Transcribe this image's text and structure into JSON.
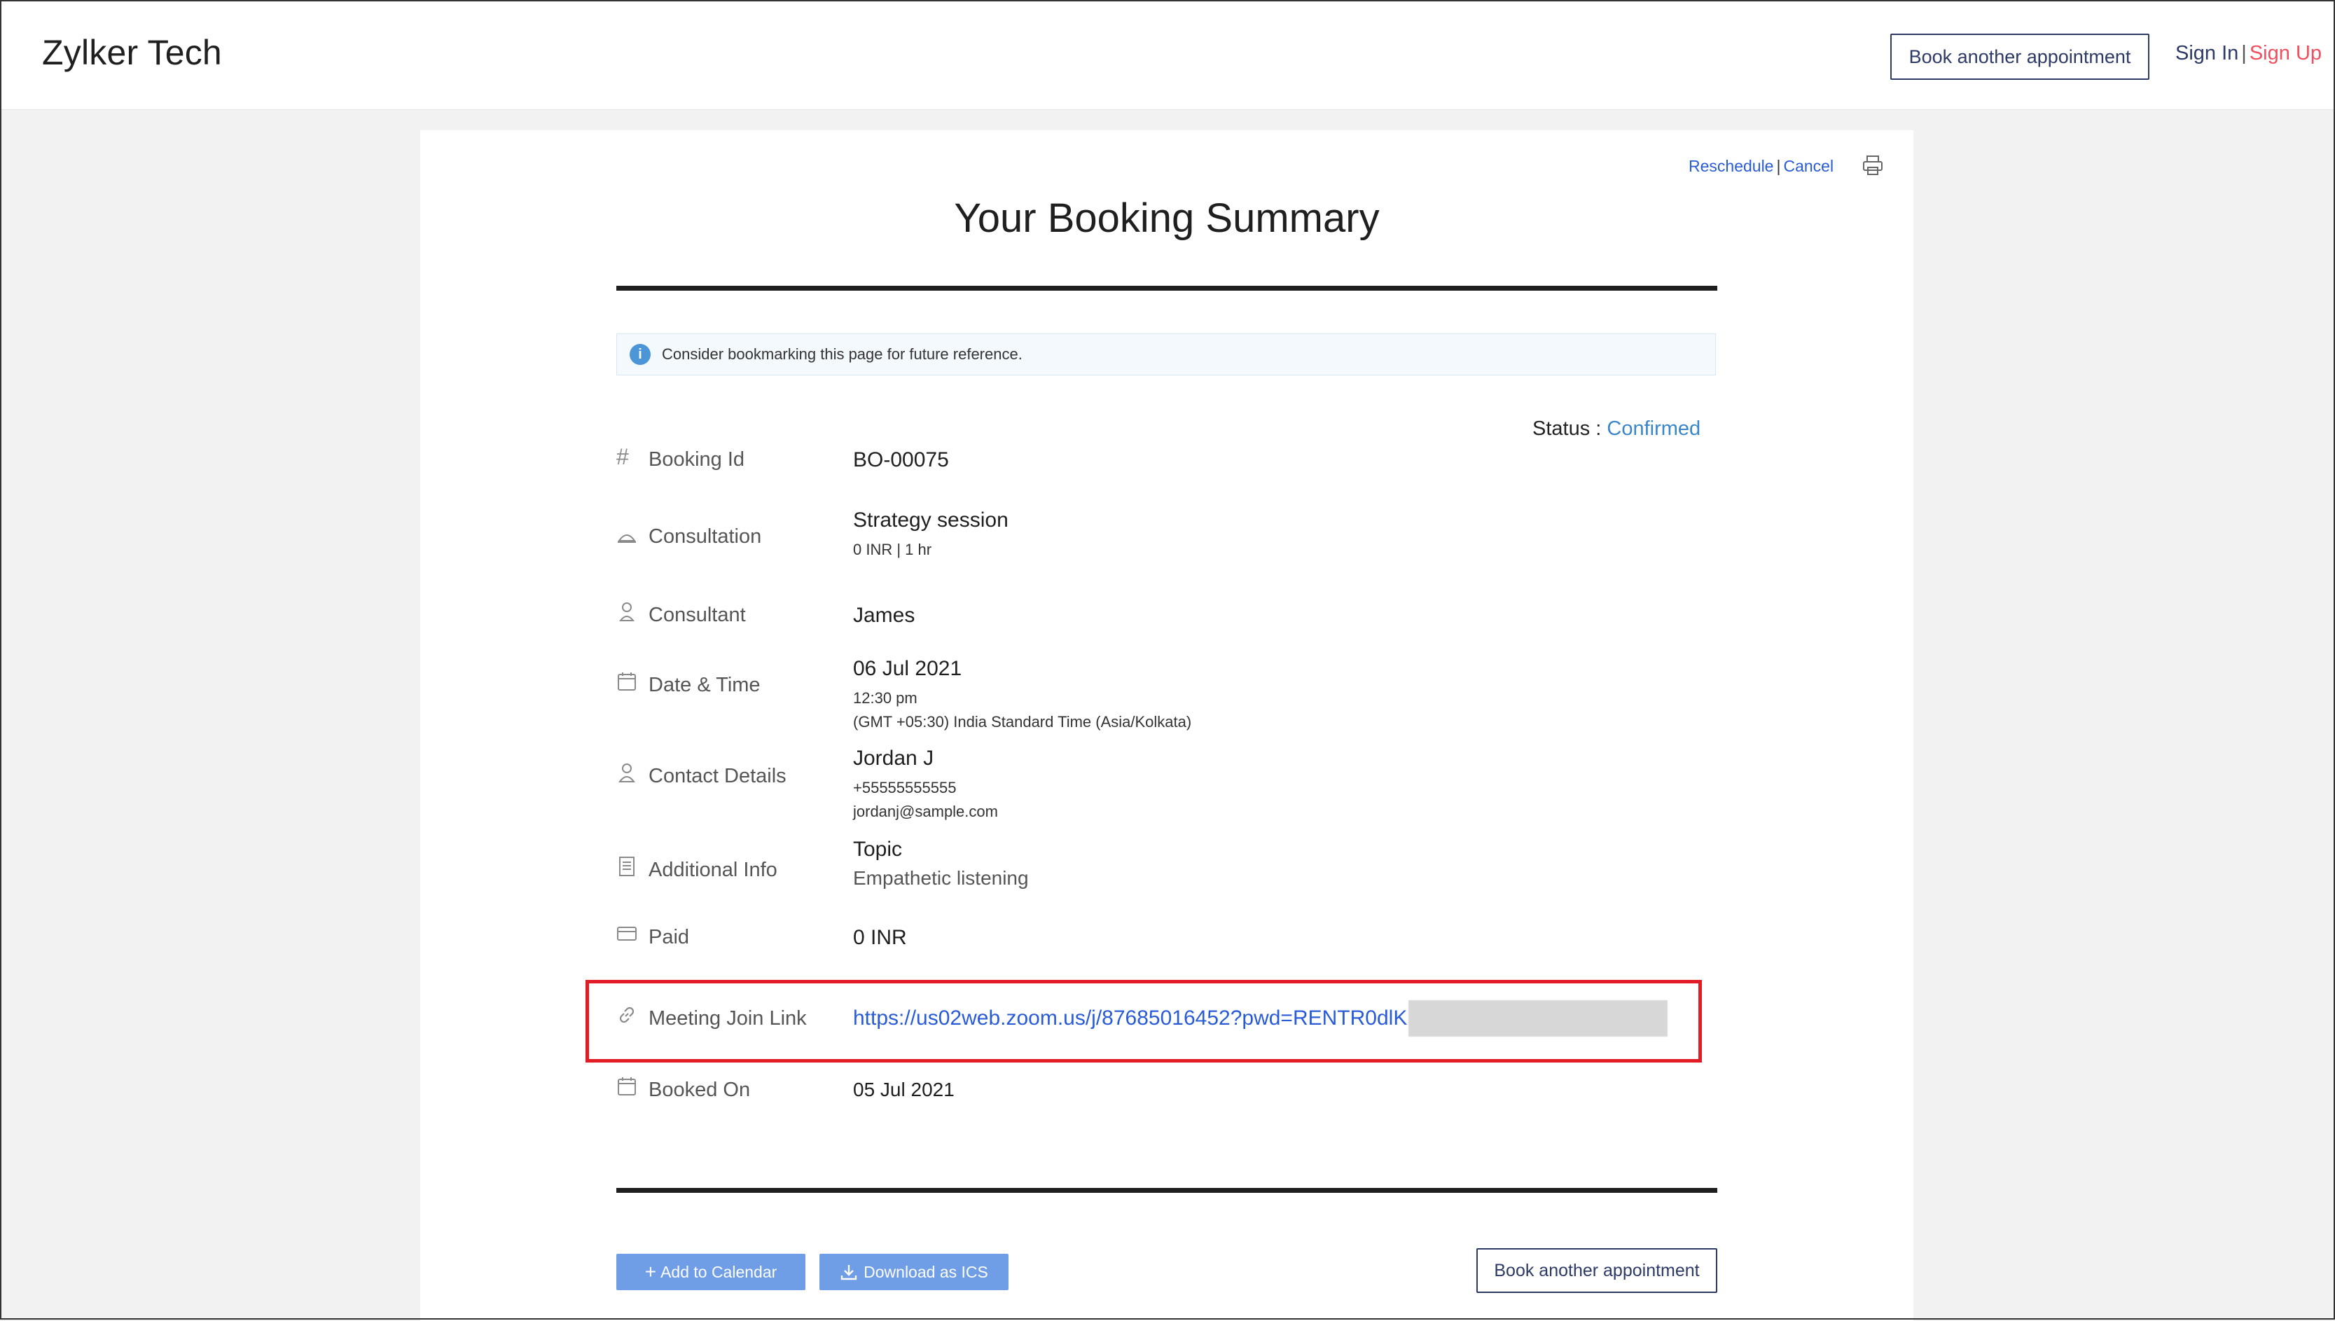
{
  "header": {
    "brand": "Zylker Tech",
    "book_another": "Book another appointment",
    "sign_in": "Sign In",
    "separator": "|",
    "sign_up": "Sign Up"
  },
  "summary": {
    "reschedule": "Reschedule",
    "cancel": "Cancel",
    "title": "Your Booking Summary",
    "notice": "Consider bookmarking this page for future reference.",
    "status_label": "Status : ",
    "status_value": "Confirmed"
  },
  "rows": {
    "booking_id": {
      "label": "Booking Id",
      "value": "BO-00075"
    },
    "consultation": {
      "label": "Consultation",
      "value": "Strategy session",
      "sub": "0 INR | 1 hr"
    },
    "consultant": {
      "label": "Consultant",
      "value": "James"
    },
    "date_time": {
      "label": "Date & Time",
      "value": "06 Jul 2021",
      "time": "12:30 pm",
      "tz": "(GMT +05:30) India Standard Time (Asia/Kolkata)"
    },
    "contact": {
      "label": "Contact Details",
      "name": "Jordan J",
      "phone": "+55555555555",
      "email": "jordanj@sample.com"
    },
    "additional": {
      "label": "Additional Info",
      "key": "Topic",
      "value": "Empathetic listening"
    },
    "paid": {
      "label": "Paid",
      "value": "0 INR"
    },
    "meeting": {
      "label": "Meeting Join Link",
      "value": "https://us02web.zoom.us/j/87685016452?pwd=RENTR0dlK"
    },
    "booked_on": {
      "label": "Booked On",
      "value": "05 Jul 2021"
    }
  },
  "footer": {
    "add_calendar": "Add to Calendar",
    "download_ics": "Download as ICS",
    "book_another": "Book another appointment"
  },
  "colors": {
    "accent_blue": "#2a5bd7",
    "status_blue": "#3a86c8",
    "button_blue": "#6f9de6",
    "sign_up_red": "#ef4f5f",
    "highlight_red": "#e11c24"
  },
  "icons": {
    "booking_id": "hash-icon",
    "consultation": "service-bell-icon",
    "consultant": "person-pin-icon",
    "date_time": "calendar-icon",
    "contact": "user-icon",
    "additional": "document-icon",
    "paid": "credit-card-icon",
    "meeting": "link-icon",
    "booked_on": "calendar-icon",
    "print": "printer-icon",
    "info": "info-icon"
  }
}
